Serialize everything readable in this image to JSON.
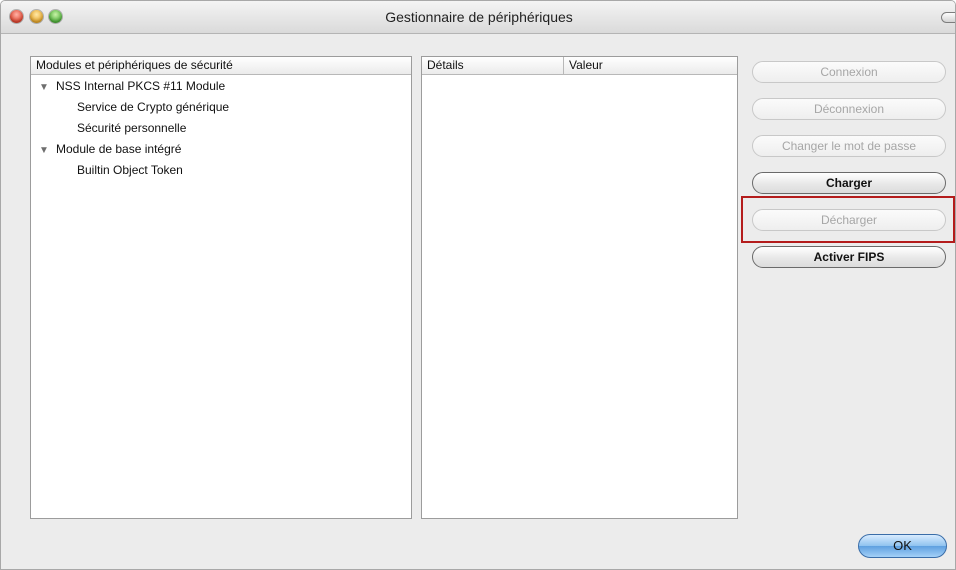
{
  "window": {
    "title": "Gestionnaire de périphériques"
  },
  "tree": {
    "header": "Modules et périphériques de sécurité",
    "rows": [
      {
        "label": "NSS Internal PKCS #11 Module",
        "expanded": true,
        "level": 0
      },
      {
        "label": "Service de Crypto générique",
        "level": 1
      },
      {
        "label": "Sécurité personnelle",
        "level": 1
      },
      {
        "label": "Module de base intégré",
        "expanded": true,
        "level": 0
      },
      {
        "label": "Builtin Object Token",
        "level": 1
      }
    ]
  },
  "details": {
    "col_details": "Détails",
    "col_value": "Valeur"
  },
  "buttons": {
    "connexion": "Connexion",
    "deconnexion": "Déconnexion",
    "changer_mdp": "Changer le mot de passe",
    "charger": "Charger",
    "decharger": "Décharger",
    "activer_fips": "Activer FIPS",
    "ok": "OK"
  },
  "colors": {
    "highlight": "#b41c1c",
    "default_button": "#5fa0e0"
  }
}
